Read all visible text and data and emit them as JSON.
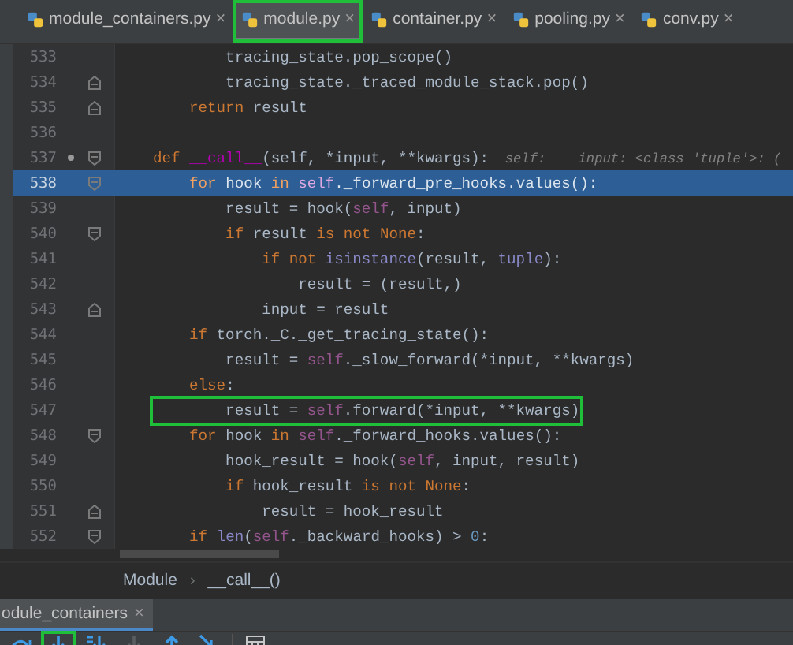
{
  "tabs": [
    {
      "label": "module_containers.py",
      "selected": false,
      "highlighted": false
    },
    {
      "label": "module.py",
      "selected": true,
      "highlighted": true
    },
    {
      "label": "container.py",
      "selected": false,
      "highlighted": false
    },
    {
      "label": "pooling.py",
      "selected": false,
      "highlighted": false
    },
    {
      "label": "conv.py",
      "selected": false,
      "highlighted": false
    }
  ],
  "close_glyph": "×",
  "lines": [
    {
      "number": "533",
      "fold_start": false,
      "fold_end": false,
      "current": false,
      "highlighted": false,
      "tokens": [
        {
          "kind": "plain",
          "text": "        tracing_state.pop_scope()"
        }
      ]
    },
    {
      "number": "534",
      "fold_start": false,
      "fold_end": true,
      "current": false,
      "highlighted": false,
      "tokens": [
        {
          "kind": "plain",
          "text": "        tracing_state._traced_module_stack.pop()"
        }
      ]
    },
    {
      "number": "535",
      "fold_start": false,
      "fold_end": true,
      "current": false,
      "highlighted": false,
      "tokens": [
        {
          "kind": "keyword",
          "text": "    return"
        },
        {
          "kind": "plain",
          "text": " result"
        }
      ]
    },
    {
      "number": "536",
      "fold_start": false,
      "fold_end": false,
      "current": false,
      "highlighted": false
    },
    {
      "number": "537",
      "fold_start": true,
      "fold_end": false,
      "marker": true,
      "current": false,
      "highlighted": false,
      "tokens": [
        {
          "kind": "keyword",
          "text": "def "
        },
        {
          "kind": "dunder",
          "text": "__call__"
        },
        {
          "kind": "plain",
          "text": "(self, *input, **kwargs):"
        },
        {
          "kind": "hint",
          "text": "  self:"
        },
        {
          "kind": "hint",
          "text": "    input: <class 'tuple'>: ("
        }
      ]
    },
    {
      "number": "538",
      "fold_start": true,
      "fold_end": false,
      "current": true,
      "highlighted": false,
      "tokens": [
        {
          "kind": "keyword",
          "text": "    for"
        },
        {
          "kind": "plain",
          "text": " hook "
        },
        {
          "kind": "keyword",
          "text": "in "
        },
        {
          "kind": "self",
          "text": "self"
        },
        {
          "kind": "plain",
          "text": "._forward_pre_hooks.values():"
        }
      ]
    },
    {
      "number": "539",
      "fold_start": false,
      "fold_end": false,
      "current": false,
      "highlighted": false,
      "tokens": [
        {
          "kind": "plain",
          "text": "        result = hook("
        },
        {
          "kind": "self",
          "text": "self"
        },
        {
          "kind": "plain",
          "text": ", input)"
        }
      ]
    },
    {
      "number": "540",
      "fold_start": true,
      "fold_end": false,
      "current": false,
      "highlighted": false,
      "tokens": [
        {
          "kind": "keyword",
          "text": "        if"
        },
        {
          "kind": "plain",
          "text": " result "
        },
        {
          "kind": "keyword",
          "text": "is not None"
        },
        {
          "kind": "plain",
          "text": ":"
        }
      ]
    },
    {
      "number": "541",
      "fold_start": false,
      "fold_end": false,
      "current": false,
      "highlighted": false,
      "tokens": [
        {
          "kind": "keyword",
          "text": "            if not "
        },
        {
          "kind": "builtin",
          "text": "isinstance"
        },
        {
          "kind": "plain",
          "text": "(result, "
        },
        {
          "kind": "builtin",
          "text": "tuple"
        },
        {
          "kind": "plain",
          "text": "):"
        }
      ]
    },
    {
      "number": "542",
      "fold_start": false,
      "fold_end": false,
      "current": false,
      "highlighted": false,
      "tokens": [
        {
          "kind": "plain",
          "text": "                result = (result,)"
        }
      ]
    },
    {
      "number": "543",
      "fold_start": false,
      "fold_end": true,
      "current": false,
      "highlighted": false,
      "tokens": [
        {
          "kind": "plain",
          "text": "            input = result"
        }
      ]
    },
    {
      "number": "544",
      "fold_start": false,
      "fold_end": false,
      "current": false,
      "highlighted": false,
      "tokens": [
        {
          "kind": "keyword",
          "text": "    if"
        },
        {
          "kind": "plain",
          "text": " torch._C._get_tracing_state():"
        }
      ]
    },
    {
      "number": "545",
      "fold_start": false,
      "fold_end": false,
      "current": false,
      "highlighted": false,
      "tokens": [
        {
          "kind": "plain",
          "text": "        result = "
        },
        {
          "kind": "self",
          "text": "self"
        },
        {
          "kind": "plain",
          "text": "._slow_forward(*input, **kwargs)"
        }
      ]
    },
    {
      "number": "546",
      "fold_start": false,
      "fold_end": false,
      "current": false,
      "highlighted": false,
      "tokens": [
        {
          "kind": "keyword",
          "text": "    else"
        },
        {
          "kind": "plain",
          "text": ":"
        }
      ]
    },
    {
      "number": "547",
      "fold_start": false,
      "fold_end": false,
      "current": false,
      "highlighted": true,
      "tokens": [
        {
          "kind": "plain",
          "text": "        result = "
        },
        {
          "kind": "self",
          "text": "self"
        },
        {
          "kind": "plain",
          "text": ".forward(*input, **kwargs)"
        }
      ]
    },
    {
      "number": "548",
      "fold_start": true,
      "fold_end": false,
      "current": false,
      "highlighted": false,
      "tokens": [
        {
          "kind": "keyword",
          "text": "    for"
        },
        {
          "kind": "plain",
          "text": " hook "
        },
        {
          "kind": "keyword",
          "text": "in "
        },
        {
          "kind": "self",
          "text": "self"
        },
        {
          "kind": "plain",
          "text": "._forward_hooks.values():"
        }
      ]
    },
    {
      "number": "549",
      "fold_start": false,
      "fold_end": false,
      "current": false,
      "highlighted": false,
      "tokens": [
        {
          "kind": "plain",
          "text": "        hook_result = hook("
        },
        {
          "kind": "self",
          "text": "self"
        },
        {
          "kind": "plain",
          "text": ", input, result)"
        }
      ]
    },
    {
      "number": "550",
      "fold_start": false,
      "fold_end": false,
      "current": false,
      "highlighted": false,
      "tokens": [
        {
          "kind": "keyword",
          "text": "        if"
        },
        {
          "kind": "plain",
          "text": " hook_result "
        },
        {
          "kind": "keyword",
          "text": "is not None"
        },
        {
          "kind": "plain",
          "text": ":"
        }
      ]
    },
    {
      "number": "551",
      "fold_start": false,
      "fold_end": true,
      "current": false,
      "highlighted": false,
      "tokens": [
        {
          "kind": "plain",
          "text": "            result = hook_result"
        }
      ]
    },
    {
      "number": "552",
      "fold_start": true,
      "fold_end": false,
      "current": false,
      "highlighted": false,
      "tokens": [
        {
          "kind": "keyword",
          "text": "    if "
        },
        {
          "kind": "builtin",
          "text": "len"
        },
        {
          "kind": "plain",
          "text": "("
        },
        {
          "kind": "self",
          "text": "self"
        },
        {
          "kind": "plain",
          "text": "._backward_hooks) > "
        },
        {
          "kind": "number",
          "text": "0"
        },
        {
          "kind": "plain",
          "text": ":"
        }
      ]
    }
  ],
  "breadcrumb": [
    "Module",
    "__call__()"
  ],
  "breadcrumb_separator": "›",
  "panel_tab": {
    "label": "odule_containers"
  },
  "toolbar": [
    {
      "kind": "step-over",
      "disabled": false,
      "highlighted": false
    },
    {
      "kind": "step-into",
      "disabled": false,
      "highlighted": true
    },
    {
      "kind": "force-step-into",
      "disabled": false,
      "highlighted": false
    },
    {
      "kind": "step-into",
      "disabled": true,
      "highlighted": false
    },
    {
      "kind": "step-out",
      "disabled": false,
      "highlighted": false
    },
    {
      "kind": "run-to-cursor",
      "disabled": false,
      "highlighted": false
    },
    {
      "kind": "evaluate",
      "disabled": false,
      "highlighted": false
    }
  ]
}
